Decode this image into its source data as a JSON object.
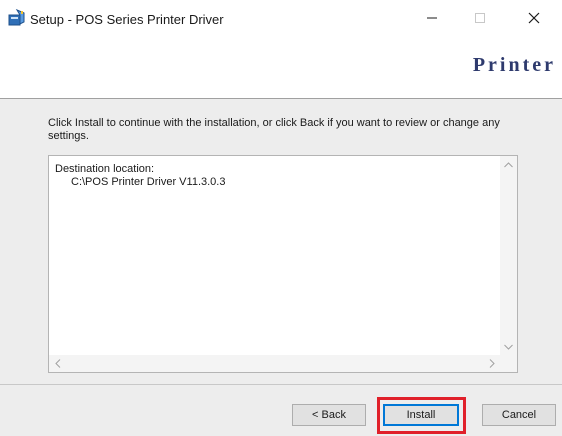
{
  "window": {
    "title": "Setup - POS Series Printer Driver",
    "icon": "setup-installer-icon",
    "controls": {
      "minimize": "minimize-icon",
      "maximize": "maximize-icon",
      "close": "close-icon"
    }
  },
  "header": {
    "brand": "Printer"
  },
  "main": {
    "instructions": "Click Install to continue with the installation, or click Back if you want to review or change any settings.",
    "memo": {
      "label": "Destination location:",
      "path": "C:\\POS Printer Driver V11.3.0.3"
    }
  },
  "footer": {
    "back_label": "< Back",
    "install_label": "Install",
    "cancel_label": "Cancel"
  },
  "colors": {
    "brand": "#2e3a6d",
    "highlight": "#e0202a",
    "default_button_border": "#0078d7",
    "panel_bg": "#ededed"
  }
}
